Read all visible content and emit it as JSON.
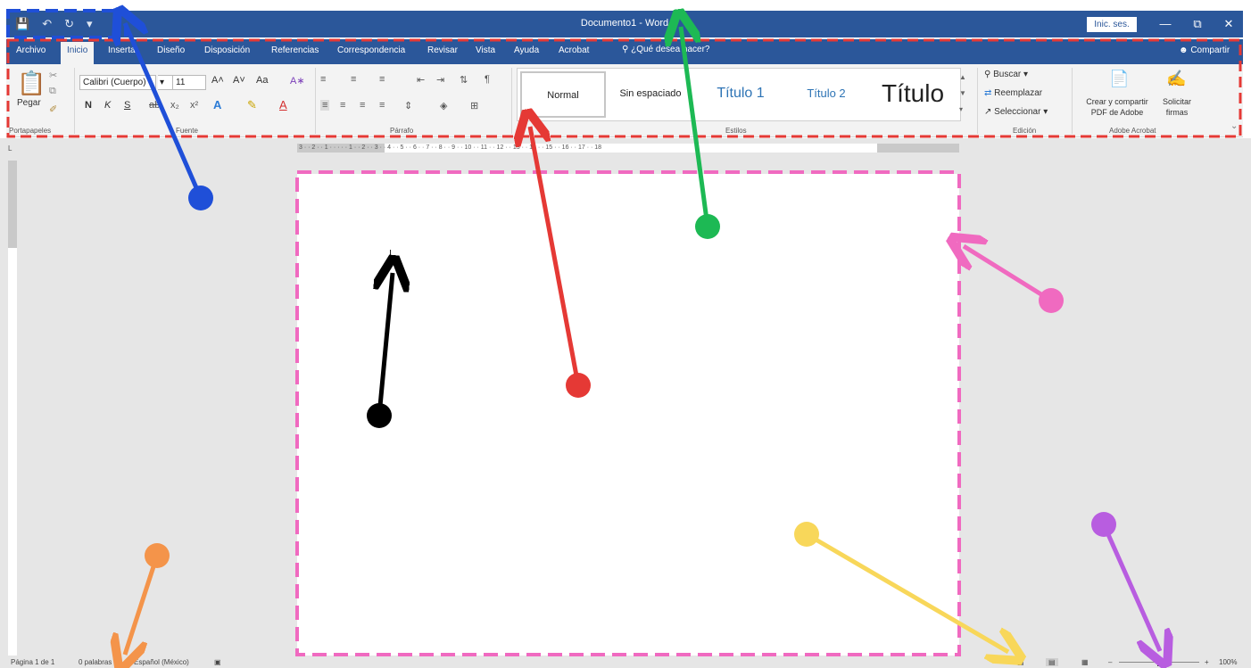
{
  "titlebar": {
    "doc_title": "Documento1 - Word",
    "signin": "Inic. ses.",
    "minimize": "—",
    "restore": "⧉",
    "close": "✕"
  },
  "tabs": [
    "Archivo",
    "Inicio",
    "Inserta",
    "Diseño",
    "Disposición",
    "Referencias",
    "Correspondencia",
    "Revisar",
    "Vista",
    "Ayuda",
    "Acrobat"
  ],
  "tellme": "¿Qué desea hacer?",
  "share": "Compartir",
  "ribbon": {
    "clipboard": {
      "paste": "Pegar",
      "label": "Portapapeles"
    },
    "font": {
      "family": "Calibri (Cuerpo)",
      "size": "11",
      "grow": "A˄",
      "shrink": "A˅",
      "case": "Aa",
      "bold": "N",
      "italic": "K",
      "underline": "S",
      "label": "Fuente"
    },
    "paragraph": {
      "label": "Párrafo"
    },
    "styles": {
      "items": [
        "Normal",
        "Sin espaciado",
        "Título 1",
        "Título 2",
        "Título"
      ],
      "label": "Estilos"
    },
    "editing": {
      "find": "Buscar",
      "replace": "Reemplazar",
      "select": "Seleccionar",
      "label": "Edición"
    },
    "acrobat": {
      "create": "Crear y compartir PDF de Adobe",
      "create_l1": "Crear y compartir",
      "create_l2": "PDF de Adobe",
      "sign": "Solicitar firmas",
      "sign_l1": "Solicitar",
      "sign_l2": "firmas",
      "label": "Adobe Acrobat"
    }
  },
  "ruler": {
    "h_ticks": "3 · · 2 · · 1 · · · · · 1 · · 2 · · 3 · · 4 · · 5 · · 6 · · 7 · · 8 · · 9 · · 10 · · 11 · · 12 · · 13 · · 14 · · 15 · · 16 · · 17 · · 18"
  },
  "status": {
    "page": "Página 1 de 1",
    "words": "0 palabras",
    "language": "Español (México)",
    "zoom": "100%"
  },
  "colors": {
    "word_blue": "#2b579a",
    "annot_blue": "#1f4fd8",
    "annot_green": "#1db954",
    "annot_red": "#e53935",
    "annot_pink": "#f06ac0",
    "annot_black": "#000000",
    "annot_orange": "#f4944a",
    "annot_yellow": "#f8d75a",
    "annot_purple": "#b85de0"
  }
}
